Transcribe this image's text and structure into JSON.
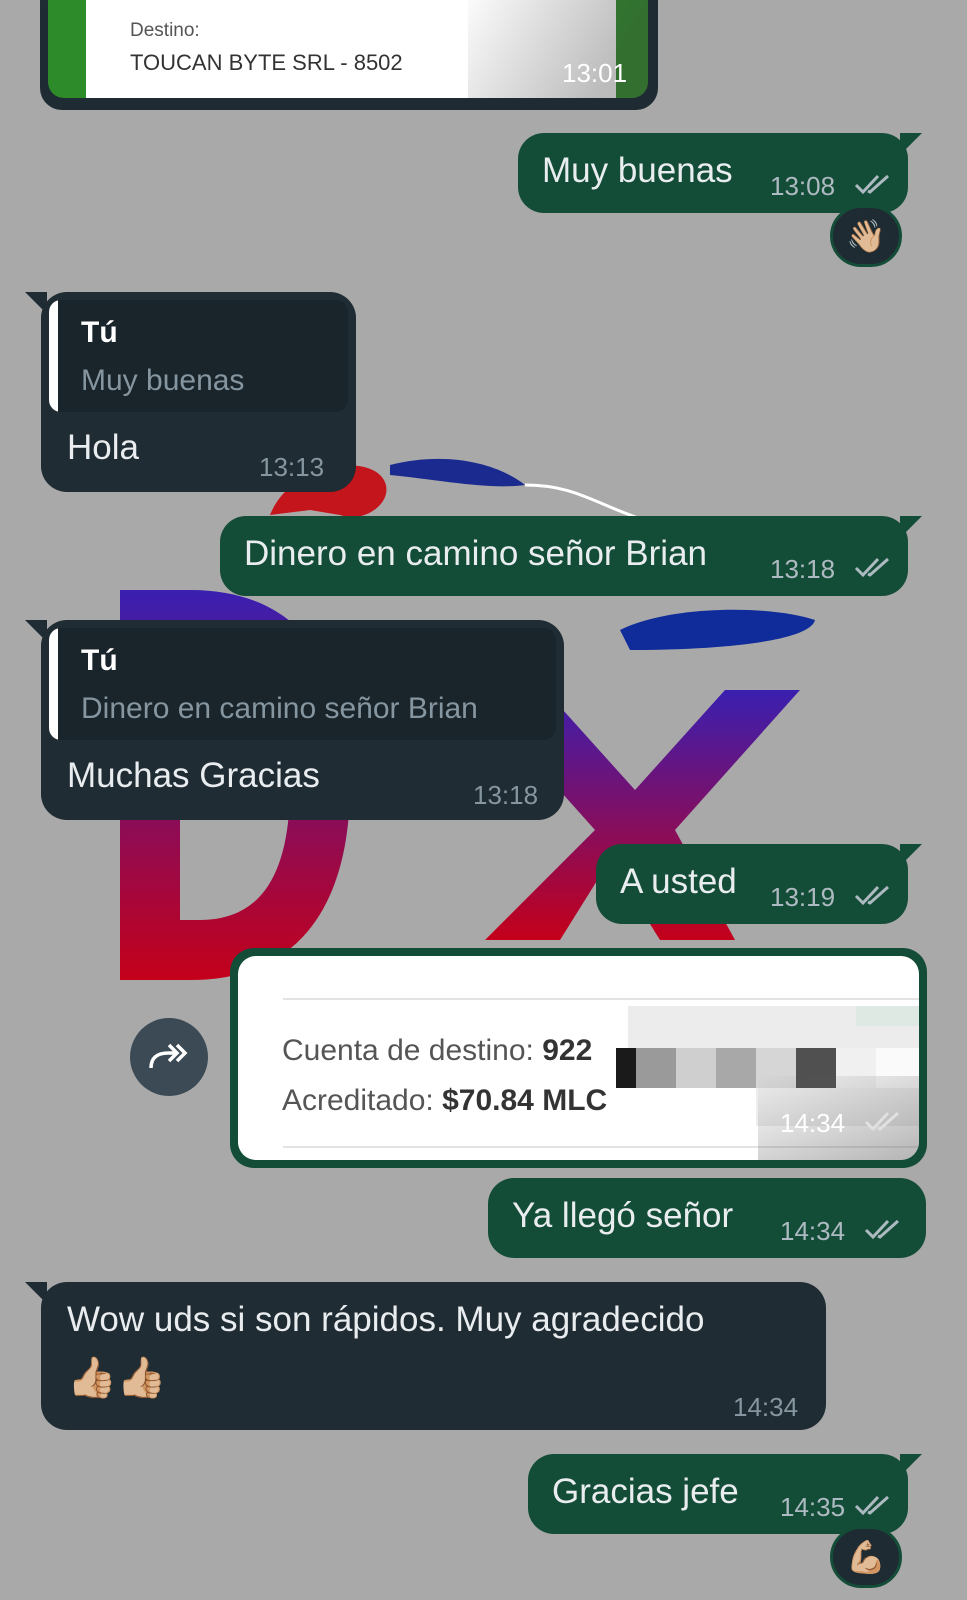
{
  "top_image": {
    "destino_label": "Destino:",
    "destino_value": "TOUCAN BYTE SRL - 8502",
    "time": "13:01"
  },
  "messages": [
    {
      "direction": "out",
      "text": "Muy buenas",
      "time": "13:08",
      "status": "read",
      "reaction": "👋🏼"
    },
    {
      "direction": "in",
      "quote_author": "Tú",
      "quote_text": "Muy buenas",
      "text": "Hola",
      "time": "13:13"
    },
    {
      "direction": "out",
      "text": "Dinero en camino señor Brian",
      "time": "13:18",
      "status": "read"
    },
    {
      "direction": "in",
      "quote_author": "Tú",
      "quote_text": "Dinero en camino señor Brian",
      "text": "Muchas Gracias",
      "time": "13:18"
    },
    {
      "direction": "out",
      "text": "A usted",
      "time": "13:19",
      "status": "read"
    },
    {
      "direction": "out",
      "type": "image",
      "line1_label": "Cuenta de destino:",
      "line1_value": "922",
      "line2_label": "Acreditado:",
      "line2_value": "$70.84 MLC",
      "time": "14:34",
      "status": "read"
    },
    {
      "direction": "out",
      "text": "Ya llegó señor",
      "time": "14:34",
      "status": "read"
    },
    {
      "direction": "in",
      "text": "Wow uds si son rápidos. Muy agradecido",
      "emoji": "👍🏼👍🏼",
      "time": "14:34"
    },
    {
      "direction": "out",
      "text": "Gracias jefe",
      "time": "14:35",
      "status": "read",
      "reaction": "💪🏼"
    }
  ],
  "icons": {
    "forward": "forward-icon",
    "read": "double-check-icon"
  },
  "colors": {
    "background": "#a9a9a9",
    "outgoing": "#144d37",
    "incoming": "#202c33"
  }
}
